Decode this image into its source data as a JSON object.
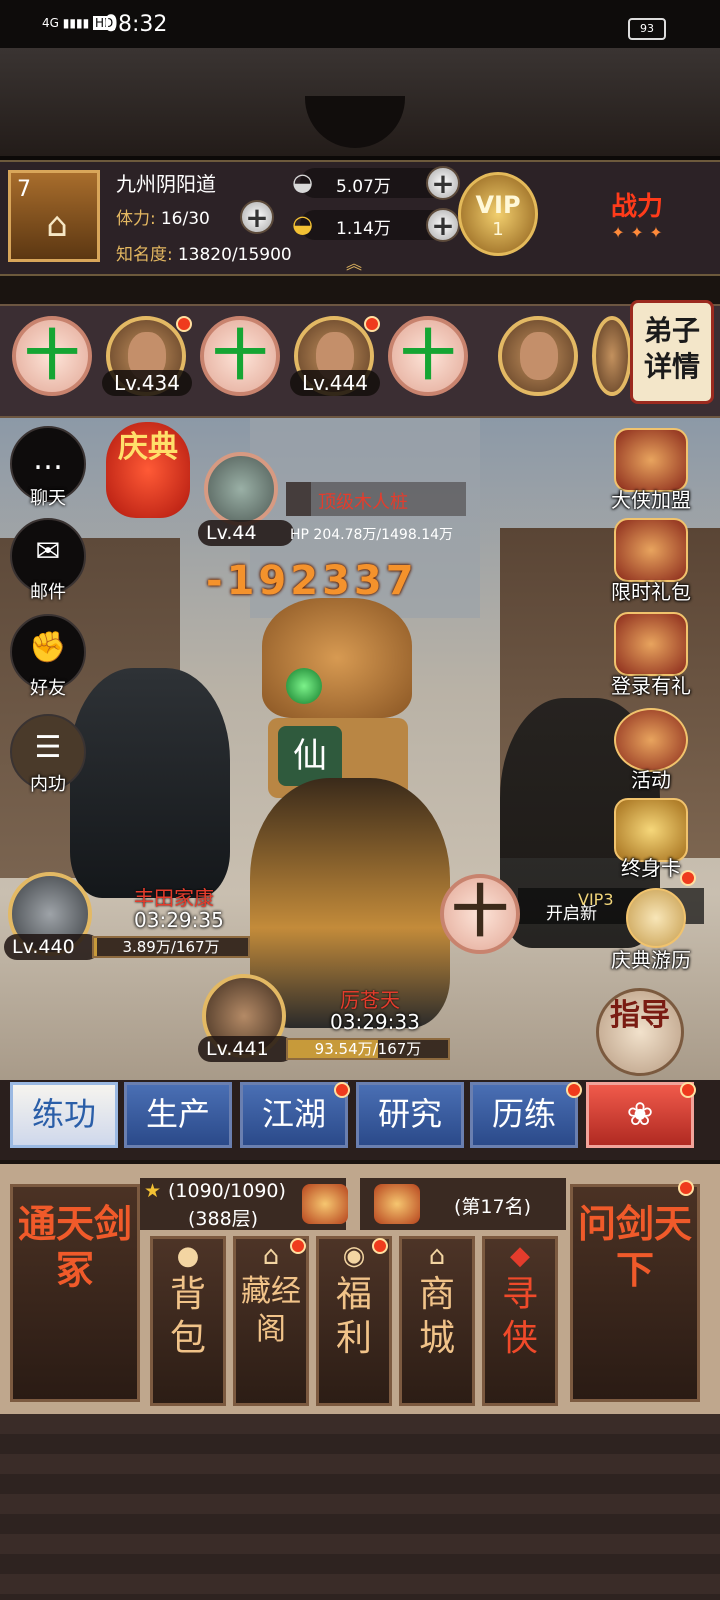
{
  "status_bar": {
    "network": "4G",
    "hd": "HD",
    "time": "08:32",
    "battery": "93"
  },
  "player": {
    "level": "7",
    "name": "九州阴阳道",
    "stamina_label": "体力:",
    "stamina_value": "16/30",
    "fame_label": "知名度:",
    "fame_value": "13820/15900",
    "silver": "5.07万",
    "gold": "1.14万",
    "vip_label": "VIP",
    "vip_level": "1",
    "power_label": "战力"
  },
  "team": {
    "slots": [
      {
        "type": "empty",
        "symbol": "十"
      },
      {
        "type": "hero",
        "level": "Lv.434"
      },
      {
        "type": "empty",
        "symbol": "十"
      },
      {
        "type": "hero",
        "level": "Lv.444"
      },
      {
        "type": "empty",
        "symbol": "十"
      },
      {
        "type": "hero",
        "level": ""
      }
    ],
    "disciple_button": "弟子详情"
  },
  "left_menu": [
    {
      "label": "聊天",
      "icon": "chat-icon"
    },
    {
      "label": "邮件",
      "icon": "mail-icon"
    },
    {
      "label": "好友",
      "icon": "friends-icon"
    },
    {
      "label": "内功",
      "icon": "inner-power-icon"
    }
  ],
  "celebration_badge": "庆典",
  "right_menu": [
    {
      "label": "大侠加盟",
      "icon": "hero-join-icon"
    },
    {
      "label": "限时礼包",
      "icon": "limited-gift-icon"
    },
    {
      "label": "登录有礼",
      "icon": "login-gift-icon"
    },
    {
      "label": "活动",
      "icon": "event-icon"
    },
    {
      "label": "终身卡",
      "icon": "lifetime-card-icon"
    },
    {
      "label": "庆典游历",
      "icon": "celebration-travel-icon"
    }
  ],
  "vip_promo": {
    "vip": "VIP3",
    "text": "开启新"
  },
  "enemy": {
    "name": "顶级木人桩",
    "level": "Lv.44",
    "hp": "HP 204.78万/1498.14万",
    "hp_fraction": 0.137
  },
  "damage": "-192337",
  "toad_badge": "仙",
  "fighters": [
    {
      "name": "丰田家康",
      "timer": "03:29:35",
      "level": "Lv.440",
      "hp": "3.89万/167万",
      "hp_fraction": 0.023
    },
    {
      "name": "厉苍天",
      "timer": "03:29:33",
      "level": "Lv.441",
      "hp": "93.54万/167万",
      "hp_fraction": 0.56
    }
  ],
  "add_fighter_symbol": "十",
  "guide_button": "指导",
  "tabs": [
    {
      "label": "练功",
      "active": true
    },
    {
      "label": "生产",
      "active": false
    },
    {
      "label": "江湖",
      "active": false
    },
    {
      "label": "研究",
      "active": false
    },
    {
      "label": "历练",
      "active": false
    }
  ],
  "bottom": {
    "left_banner": "通天剑冢",
    "right_banner": "问剑天下",
    "progress": "(1090/1090)",
    "floor": "(388层)",
    "rank": "(第17名)",
    "buttons": [
      {
        "label": "背包",
        "icon": "bag-icon",
        "glyph": "●"
      },
      {
        "label": "藏经阁",
        "icon": "library-icon",
        "glyph": "⌂"
      },
      {
        "label": "福利",
        "icon": "welfare-icon",
        "glyph": "◉"
      },
      {
        "label": "商城",
        "icon": "shop-icon",
        "glyph": "⌂"
      },
      {
        "label": "寻侠",
        "icon": "seek-hero-icon",
        "glyph": "◆"
      }
    ]
  },
  "colors": {
    "accent_gold": "#e4b861",
    "tab_blue": "#2b4a8a",
    "enemy_red": "#e43c2c",
    "damage_orange": "#f4922c"
  }
}
